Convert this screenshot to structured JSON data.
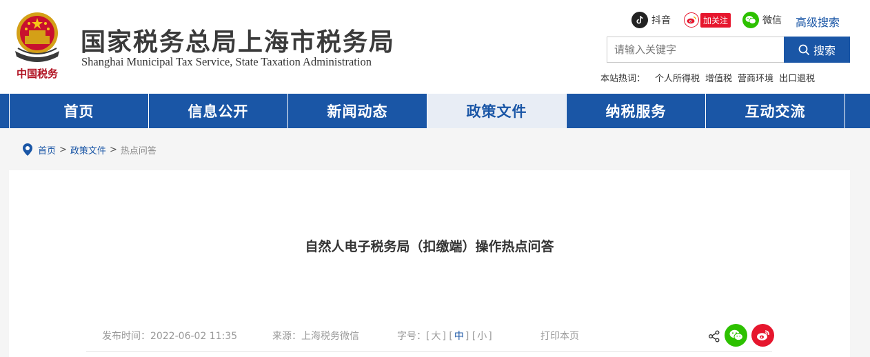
{
  "header": {
    "title": "国家税务总局上海市税务局",
    "subtitle": "Shanghai Municipal Tax Service, State Taxation Administration",
    "emblem_text": "中国税务",
    "social": {
      "douyin_label": "抖音",
      "weibo_label": "加关注",
      "wechat_label": "微信"
    },
    "advanced_search": "高级搜索",
    "search": {
      "placeholder": "请输入关键字",
      "button_label": "搜索"
    },
    "hot": {
      "label": "本站热词：",
      "words": [
        "个人所得税",
        "增值税",
        "营商环境",
        "出口退税"
      ]
    }
  },
  "nav": {
    "items": [
      "首页",
      "信息公开",
      "新闻动态",
      "政策文件",
      "纳税服务",
      "互动交流"
    ],
    "active_index": 3
  },
  "breadcrumb": {
    "items": [
      "首页",
      "政策文件"
    ],
    "separator": ">",
    "current": "热点问答"
  },
  "article": {
    "title": "自然人电子税务局（扣缴端）操作热点问答",
    "publish_time": "发布时间：2022-06-02 11:35",
    "source": "来源：上海税务微信",
    "font_size_label": "字号：",
    "font_sizes": [
      "大",
      "中",
      "小"
    ],
    "active_font_size": "中",
    "print": "打印本页"
  },
  "colors": {
    "brand_blue": "#1a56a6",
    "wechat_green": "#2dc100",
    "weibo_red": "#e6162d"
  }
}
